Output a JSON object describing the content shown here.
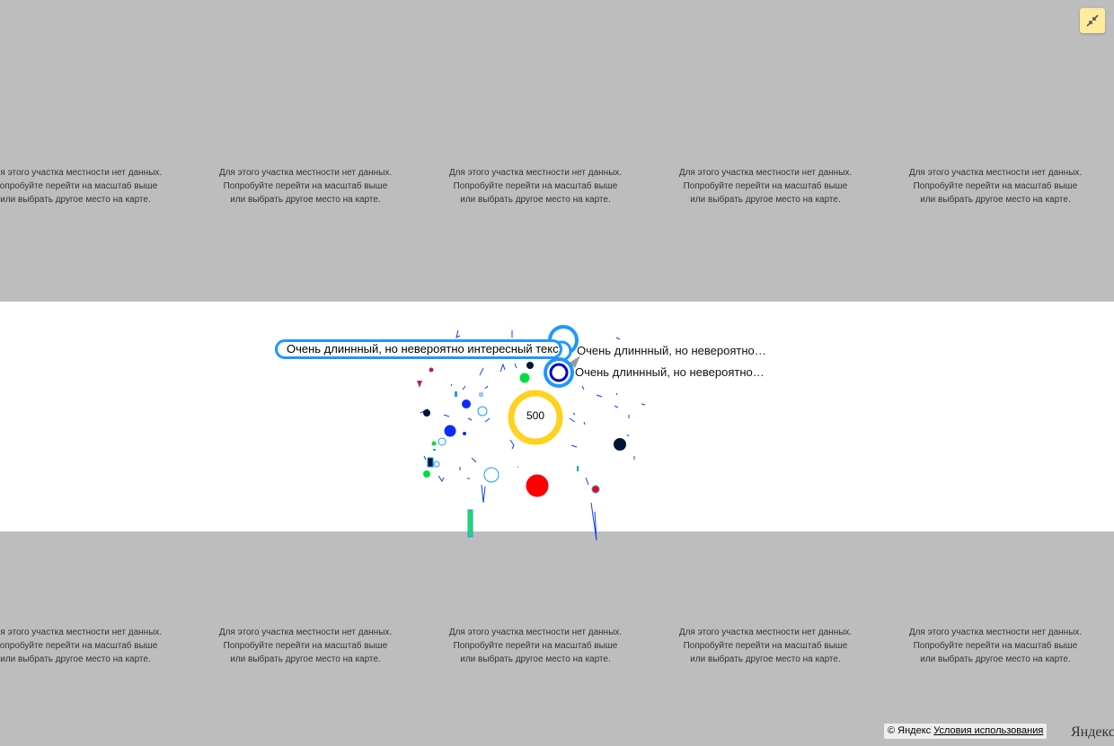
{
  "nodata_text": {
    "line1": "Для этого участка местности нет данных.",
    "line2": "Попробуйте перейти на масштаб выше",
    "line3": "или выбрать другое место на карте."
  },
  "controls": {
    "fullscreen_icon": "collapse-icon",
    "accent": "#ffeb9c"
  },
  "markers": {
    "long_hint_text": "Очень длиннный, но невероятно интересный текст",
    "hint_1": "Очень длиннный, но невероятно…",
    "hint_2": "Очень длиннный, но невероятно…",
    "cluster_count": "500",
    "colors": {
      "blue": "#1e98ff",
      "dark_blue": "#0000ff",
      "yellow": "#ffd21e",
      "red": "#ff0000",
      "green": "#00ff00",
      "navy": "#001433"
    }
  },
  "copyrights": {
    "prefix": "© Яндекс",
    "terms_link": "Условия использования",
    "logo": "Яндекс"
  }
}
